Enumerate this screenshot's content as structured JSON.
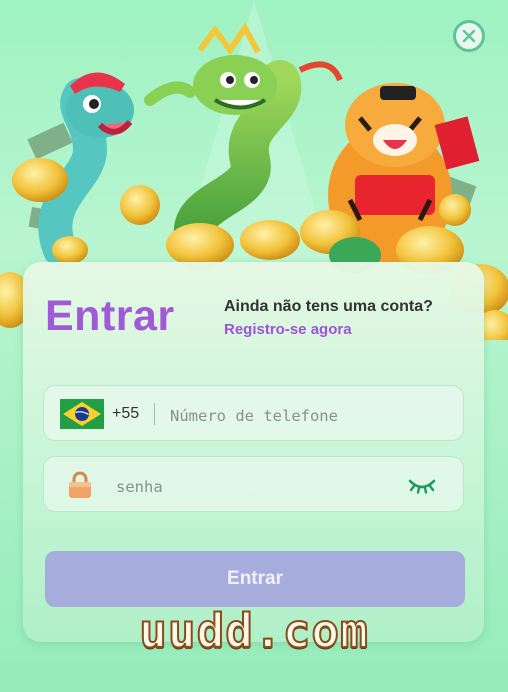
{
  "login": {
    "title": "Entrar",
    "no_account": "Ainda não tens uma conta?",
    "register_link": "Registro-se agora",
    "phone": {
      "country_code": "+55",
      "placeholder": "Número de telefone",
      "value": ""
    },
    "password": {
      "placeholder": "senha",
      "value": ""
    },
    "submit_label": "Entrar"
  },
  "watermark": "uudd.com",
  "icons": {
    "close": "close-icon",
    "flag": "brazil-flag-icon",
    "lock": "lock-icon",
    "eye": "eye-closed-icon"
  },
  "colors": {
    "title": "#a05ad8",
    "link": "#9a55d6",
    "button": "#a6acdc",
    "accent_green": "#5fc39a"
  }
}
